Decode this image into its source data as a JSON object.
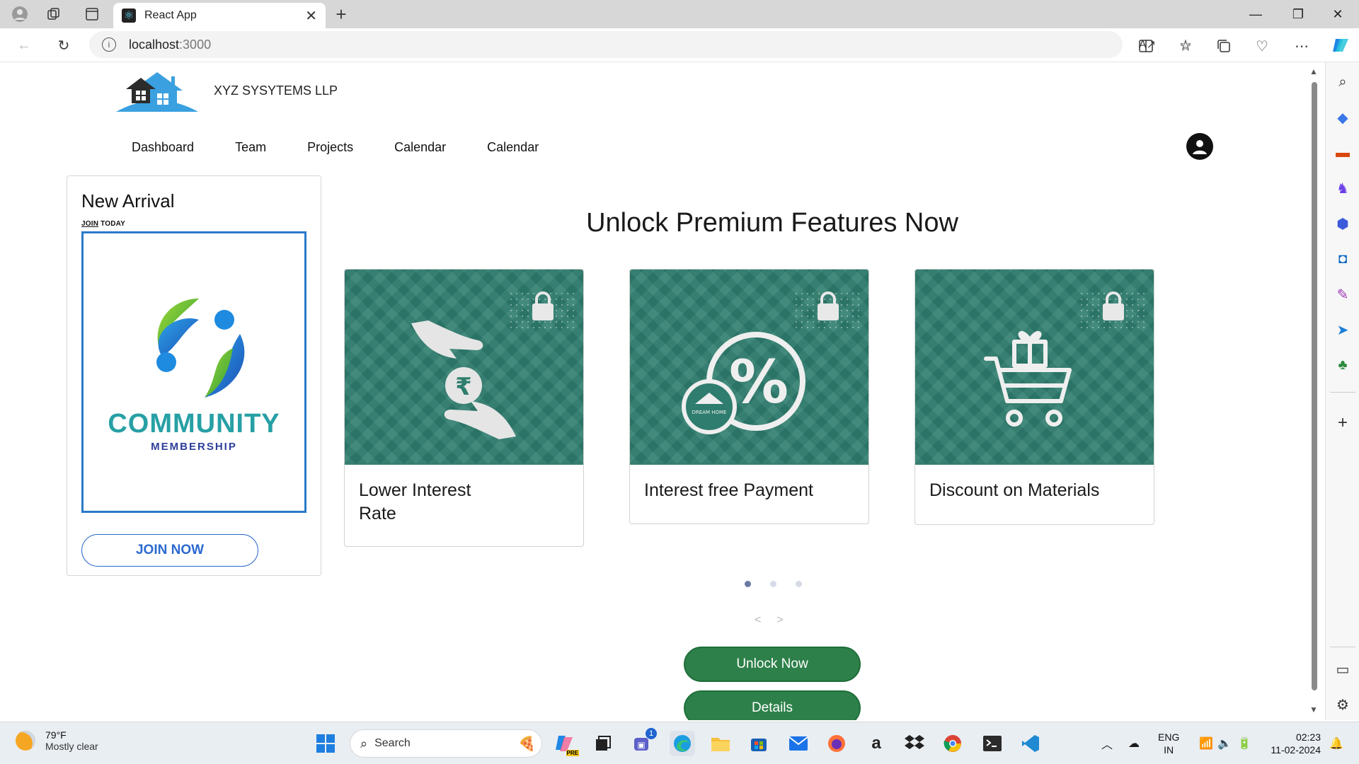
{
  "browser": {
    "tab_title": "React App",
    "url_host": "localhost",
    "url_port": ":3000"
  },
  "header": {
    "brand": "XYZ SYSYTEMS LLP",
    "nav": [
      "Dashboard",
      "Team",
      "Projects",
      "Calendar",
      "Calendar"
    ]
  },
  "arrival": {
    "heading": "New Arrival",
    "sub_underlined": "JOIN",
    "sub_rest": " TODAY",
    "logo_line1": "COMMUNITY",
    "logo_line2": "MEMBERSHIP",
    "join_label": "JOIN NOW"
  },
  "premium": {
    "title": "Unlock Premium Features Now",
    "features": [
      {
        "caption": "Lower Interest Rate",
        "icon": "rupee-hands-icon"
      },
      {
        "caption": "Interest free Payment",
        "icon": "percent-icon"
      },
      {
        "caption": "Discount on Materials",
        "icon": "gift-cart-icon"
      }
    ],
    "dream_home_text": "DREAM HOME",
    "percent_symbol": "%",
    "rupee_symbol": "₹",
    "active_slide": 1,
    "slide_count": 3,
    "prev": "<",
    "next": ">",
    "unlock_label": "Unlock Now",
    "details_label": "Details"
  },
  "taskbar": {
    "weather_temp": "79°F",
    "weather_desc": "Mostly clear",
    "search_label": "Search",
    "lang1": "ENG",
    "lang2": "IN",
    "time": "02:23",
    "date": "11-02-2024",
    "teams_badge": "1",
    "copilot_badge": "PRE"
  },
  "colors": {
    "card_green": "#2e7d6e",
    "button_green": "#2d8049",
    "join_blue": "#2b6ad0"
  }
}
